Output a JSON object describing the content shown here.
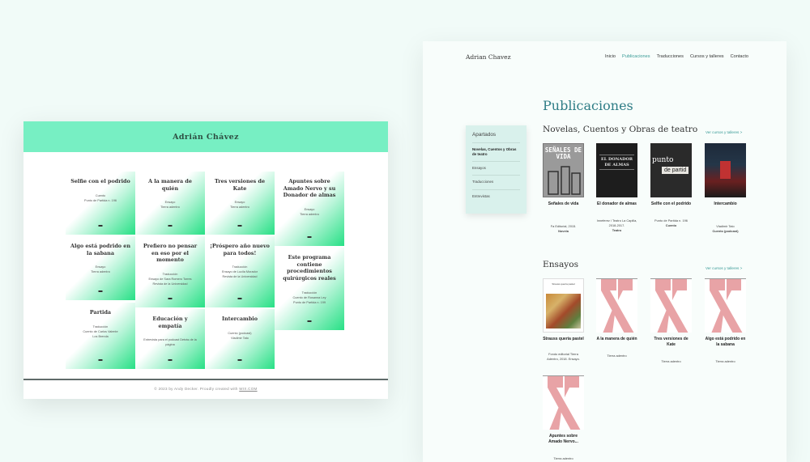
{
  "left": {
    "site_title": "Adrián Chávez",
    "tiles": [
      {
        "title": "Selfie con el podrido",
        "sub": [
          "Cuento",
          "Punto de Partida n. 196"
        ]
      },
      {
        "title": "A la manera de quién",
        "sub": [
          "Ensayo",
          "Tierra adentro"
        ]
      },
      {
        "title": "Tres versiones de Kate",
        "sub": [
          "Ensayo",
          "Tierra adentro"
        ]
      },
      {
        "title": "Apuntes sobre Amado Nervo y su Donador de almas",
        "sub": [
          "Ensayo",
          "Tierra adentro"
        ]
      },
      {
        "title": "Algo está podrido en la sabana",
        "sub": [
          "Ensayo",
          "Tierra adentro"
        ]
      },
      {
        "title": "Prefiero no pensar en eso por el momento",
        "sub": [
          "Traducción",
          "Ensayo de Sara Romero Torres",
          "Revista de la Universidad"
        ]
      },
      {
        "title": "¡Próspero año nuevo para todos!",
        "sub": [
          "Traducción",
          "Ensayo de Lucila Morador",
          "Revista de la Universidad"
        ]
      },
      {
        "title": "Este programa contiene procedimientos quirúrgicos reales",
        "sub": [
          "Traducción",
          "Cuento de Rosanna Ley",
          "Punto de Partida n. 199"
        ]
      },
      {
        "title": "Partida",
        "sub": [
          "Traducción",
          "Cuento de Carlos Valente",
          "Los Brenda"
        ]
      },
      {
        "title": "Educación y empatía",
        "sub": [
          "Entrevista para el podcast Detrás de la",
          "página"
        ]
      },
      {
        "title": "Intercambio",
        "sub": [
          "Cuento (podcast)",
          "Vladimir Tato"
        ]
      }
    ],
    "footer_text": "© 2023 by Andy Decker. Proudly created with ",
    "footer_link": "WIX.COM"
  },
  "right": {
    "brand": "Adrian Chavez",
    "nav": [
      "Inicio",
      "Publicaciones",
      "Traducciones",
      "Cursos y talleres",
      "Contacto"
    ],
    "nav_active": "Publicaciones",
    "page_title": "Publicaciones",
    "sidebar": {
      "heading": "Apartados",
      "items": [
        "Novelas, Cuentos y Obras de teatro",
        "Ensayos",
        "Traducciones",
        "Entrevistas"
      ]
    },
    "section1": {
      "title": "Novelas, Cuentos y Obras de teatro",
      "link": "Ver cursos y talleres >",
      "books": [
        {
          "title": "Señales de vida",
          "meta": "Fa Editorial, 2015.",
          "bold": "Novela",
          "cover_text": "SEÑALES DE VIDA"
        },
        {
          "title": "El donador de almas",
          "meta": "Inneferez / Teatro La Capilla, 2018-2017.",
          "bold": "Teatro",
          "cover_text": "EL DONADOR DE ALMAS"
        },
        {
          "title": "Selfie con el podrido",
          "meta": "Punto de Partida n. 196",
          "bold": "Cuento",
          "cover_text": "punto",
          "cover_badge": "de partid"
        },
        {
          "title": "Intercambio",
          "meta": "Vladimir Tato",
          "bold": "Cuento (podcast)"
        }
      ]
    },
    "section2": {
      "title": "Ensayos",
      "link": "Ver cursos y talleres >",
      "books": [
        {
          "title": "Strauss quería pastel",
          "meta": "Fondo editorial Tierra Adentro, 2018. Ensayo.",
          "cover_text": "Strauss quería pastel"
        },
        {
          "title": "A la manera de quién",
          "meta": "Tierra adentro"
        },
        {
          "title": "Tres versiones de Kate",
          "meta": "Tierra adentro"
        },
        {
          "title": "Algo está podrido en la sabana",
          "meta": "Tierra adentro"
        },
        {
          "title": "Apuntes sobre Amado Nervo...",
          "meta": "Tierra adentro"
        }
      ]
    }
  }
}
